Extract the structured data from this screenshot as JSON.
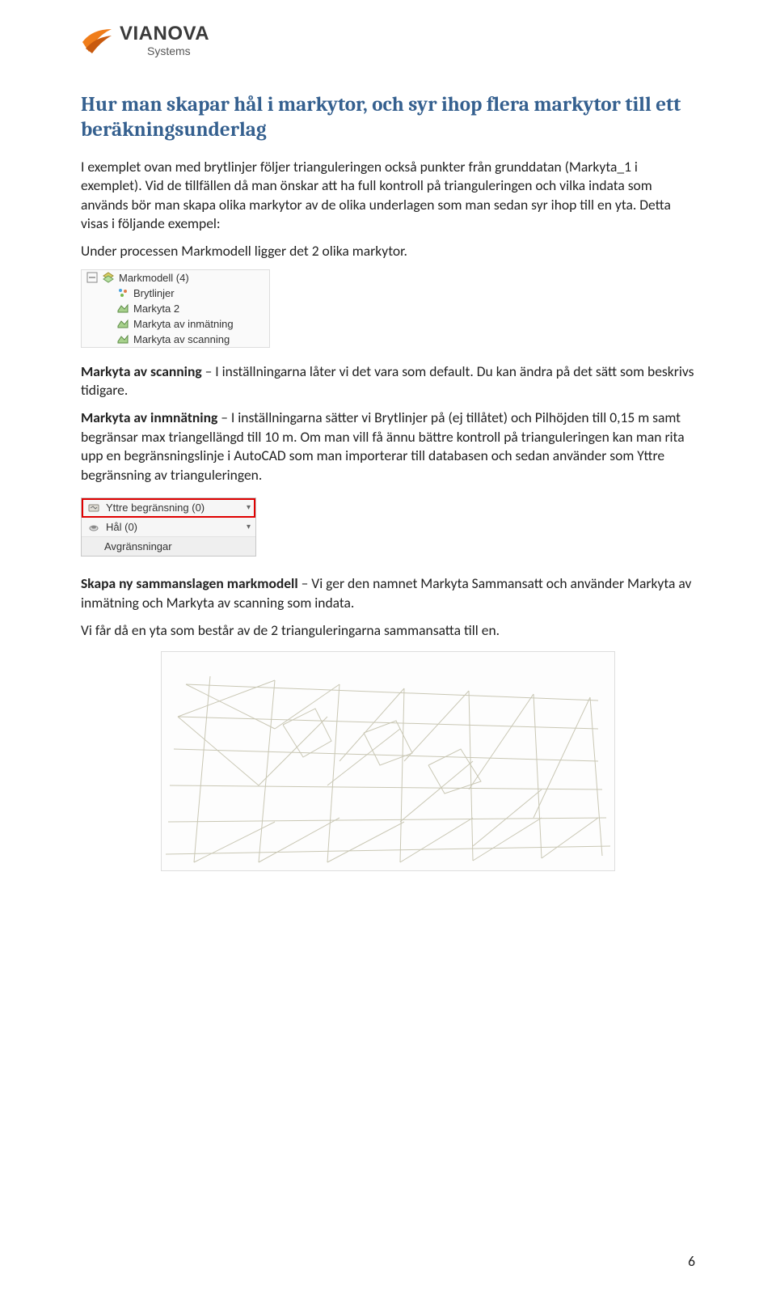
{
  "logo": {
    "brand": "VIANOVA",
    "sub": "Systems"
  },
  "heading": "Hur man skapar hål i markytor, och syr ihop flera markytor till ett beräkningsunderlag",
  "p1": "I exemplet ovan med brytlinjer följer trianguleringen också punkter från grunddatan (Markyta_1 i exemplet). Vid de tillfällen då man önskar att ha full kontroll på trianguleringen och vilka indata som används bör man skapa olika markytor av de olika underlagen som man sedan syr ihop till en yta. Detta visas i följande exempel:",
  "p2": "Under processen Markmodell ligger det 2 olika markytor.",
  "tree": {
    "root": "Markmodell (4)",
    "items": [
      "Brytlinjer",
      "Markyta 2",
      "Markyta av inmätning",
      "Markyta av scanning"
    ]
  },
  "p3_lead": "Markyta av scanning",
  "p3_rest": " – I inställningarna låter vi det vara som default. Du kan ändra på det sätt som beskrivs tidigare.",
  "p4_lead": "Markyta av inmnätning",
  "p4_rest": " – I inställningarna sätter vi Brytlinjer på (ej tillåtet) och Pilhöjden till 0,15 m samt begränsar max triangellängd till 10 m. Om man vill få ännu bättre kontroll på trianguleringen kan man rita upp en begränsningslinje i AutoCAD som man importerar till databasen och sedan använder som Yttre begränsning av trianguleringen.",
  "panel2": {
    "yttre": "Yttre begränsning (0)",
    "hal": "Hål (0)",
    "avgr": "Avgränsningar"
  },
  "p5_lead": "Skapa ny sammanslagen markmodell",
  "p5_rest": " – Vi ger den namnet Markyta Sammansatt och använder Markyta av inmätning och Markyta av scanning som indata.",
  "p6": "Vi får då en yta som består av de 2 trianguleringarna sammansatta till en.",
  "page_number": "6"
}
